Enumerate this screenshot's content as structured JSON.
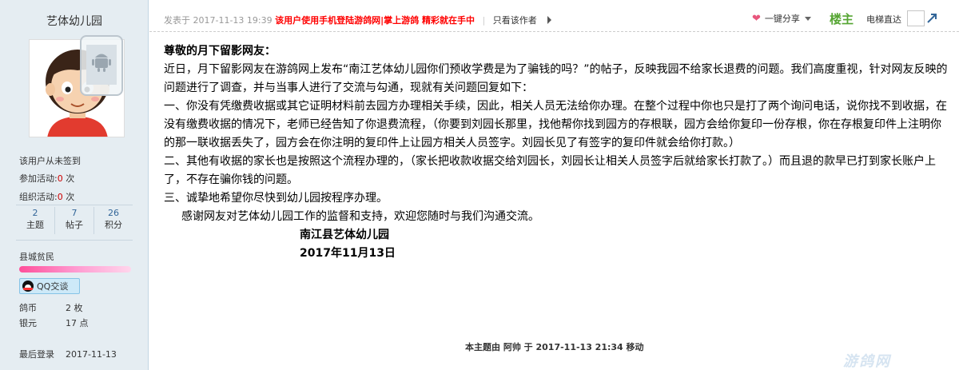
{
  "profile": {
    "username": "艺体幼儿园",
    "signin": "该用户从未签到",
    "activity_join_label": "参加活动:",
    "activity_join_count": "0",
    "activity_join_unit": "次",
    "activity_org_label": "组织活动:",
    "activity_org_count": "0",
    "activity_org_unit": "次",
    "stats": [
      {
        "num": "2",
        "label": "主题"
      },
      {
        "num": "7",
        "label": "帖子"
      },
      {
        "num": "26",
        "label": "积分"
      }
    ],
    "rank": "县城贫民",
    "qq_label": "QQ交谈",
    "coins_label": "鸽币",
    "coins_value": "2 枚",
    "silver_label": "银元",
    "silver_value": "17 点",
    "last_login_label": "最后登录",
    "last_login_value": "2017-11-13"
  },
  "post_header": {
    "posted": "发表于 2017-11-13 19:39",
    "promo": "该用户使用手机登陆游鸽网|掌上游鸽 精彩就在手中",
    "only_author": "只看该作者",
    "share": "一键分享",
    "floor": "楼主",
    "elevator": "电梯直达"
  },
  "message": {
    "greeting": "尊敬的月下留影网友：",
    "paragraphs": [
      "近日，月下留影网友在游鸽网上发布“南江艺体幼儿园你们预收学费是为了骗钱的吗？”的帖子，反映我园不给家长退费的问题。我们高度重视，针对网友反映的问题进行了调查，并与当事人进行了交流与勾通，现就有关问题回复如下：",
      "一、你没有凭缴费收据或其它证明材料前去园方办理相关手续，因此，相关人员无法给你办理。在整个过程中你也只是打了两个询问电话，说你找不到收据，在没有缴费收据的情况下，老师已经告知了你退费流程，（你要到刘园长那里，找他帮你找到园方的存根联，园方会给你复印一份存根，你在存根复印件上注明你的那一联收据丢失了，园方会在你注明的复印件上让园方相关人员签字。刘园长见了有签字的复印件就会给你打款。）",
      "二、其他有收据的家长也是按照这个流程办理的，（家长把收款收据交给刘园长，刘园长让相关人员签字后就给家长打款了。）而且退的款早已打到家长账户上了，不存在骗你钱的问题。",
      "三、诚挚地希望你尽快到幼儿园按程序办理。"
    ],
    "thanks": "感谢网友对艺体幼儿园工作的监督和支持，欢迎您随时与我们沟通交流。",
    "sig_org": "南江县艺体幼儿园",
    "sig_date": "2017年11月13日"
  },
  "moderation": "本主题由 阿帅 于 2017-11-13 21:34 移动",
  "colors": {
    "sidebar_bg": "#e5edf2",
    "promo_red": "#ff0000",
    "floor_green": "#55a532",
    "link_blue": "#336699"
  }
}
